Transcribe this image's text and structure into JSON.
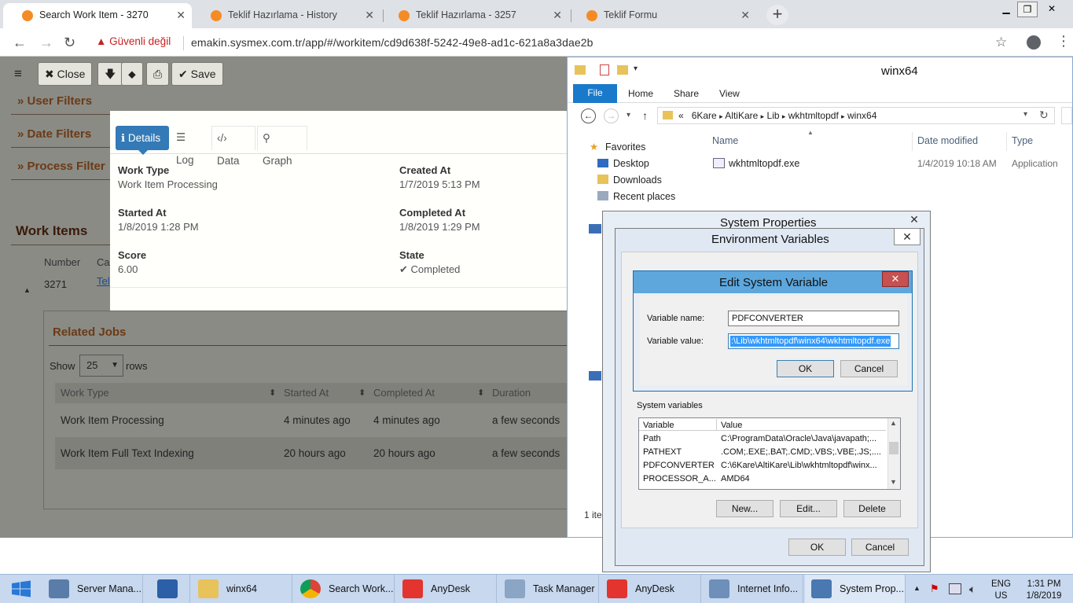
{
  "browser": {
    "tabs": [
      {
        "title": "Search Work Item - 3270",
        "active": true
      },
      {
        "title": "Teklif Hazırlama - History",
        "active": false
      },
      {
        "title": "Teklif Hazırlama - 3257",
        "active": false
      },
      {
        "title": "Teklif Formu",
        "active": false
      }
    ],
    "security_warning": "Güvenli değil",
    "url": "emakin.sysmex.com.tr/app/#/workitem/cd9d638f-5242-49e8-ad1c-621a8a3dae2b"
  },
  "toolbar": {
    "close_label": "Close",
    "save_label": "Save"
  },
  "filters": {
    "user": "» User Filters",
    "date": "» Date Filters",
    "process": "» Process Filter"
  },
  "work_items": {
    "title": "Work Items",
    "col_number": "Number",
    "col_ca": "Ca",
    "number": "3271",
    "link": "Tel"
  },
  "modal": {
    "tabs": {
      "details": "Details",
      "log": "Log",
      "data": "Data",
      "graph": "Graph"
    },
    "work_type_label": "Work Type",
    "work_type": "Work Item Processing",
    "created_at_label": "Created At",
    "created_at": "1/7/2019 5:13 PM",
    "started_at_label": "Started At",
    "started_at": "1/8/2019 1:28 PM",
    "completed_at_label": "Completed At",
    "completed_at": "1/8/2019 1:29 PM",
    "score_label": "Score",
    "score": "6.00",
    "state_label": "State",
    "state": "Completed"
  },
  "related_jobs": {
    "title": "Related Jobs",
    "show": "Show",
    "page_size": "25",
    "rows": "rows",
    "columns": [
      "Work Type",
      "Started At",
      "Completed At",
      "Duration"
    ],
    "data": [
      [
        "Work Item Processing",
        "4 minutes ago",
        "4 minutes ago",
        "a few seconds"
      ],
      [
        "Work Item Full Text Indexing",
        "20 hours ago",
        "20 hours ago",
        "a few seconds"
      ]
    ]
  },
  "explorer": {
    "title": "winx64",
    "ribbon": {
      "file": "File",
      "home": "Home",
      "share": "Share",
      "view": "View"
    },
    "path": [
      "«",
      "6Kare",
      "AltiKare",
      "Lib",
      "wkhtmltopdf",
      "winx64"
    ],
    "nav": {
      "favorites": "Favorites",
      "desktop": "Desktop",
      "downloads": "Downloads",
      "recent": "Recent places"
    },
    "columns": {
      "name": "Name",
      "date": "Date modified",
      "type": "Type"
    },
    "file": {
      "name": "wkhtmltopdf.exe",
      "date": "1/4/2019 10:18 AM",
      "type": "Application"
    },
    "status": "1 ite"
  },
  "system_properties": {
    "title": "System Properties"
  },
  "env_vars": {
    "title": "Environment Variables",
    "system_label": "System variables",
    "col_variable": "Variable",
    "col_value": "Value",
    "vars": [
      [
        "Path",
        "C:\\ProgramData\\Oracle\\Java\\javapath;..."
      ],
      [
        "PATHEXT",
        ".COM;.EXE;.BAT;.CMD;.VBS;.VBE;.JS;...."
      ],
      [
        "PDFCONVERTER",
        "C:\\6Kare\\AltiKare\\Lib\\wkhtmltopdf\\winx..."
      ],
      [
        "PROCESSOR_A...",
        "AMD64"
      ]
    ],
    "new": "New...",
    "edit": "Edit...",
    "delete": "Delete",
    "ok": "OK",
    "cancel": "Cancel"
  },
  "edit_var": {
    "title": "Edit System Variable",
    "name_label": "Variable name:",
    "name_value": "PDFCONVERTER",
    "value_label": "Variable value:",
    "value_value": ":\\Lib\\wkhtmltopdf\\winx64\\wkhtmltopdf.exe",
    "ok": "OK",
    "cancel": "Cancel"
  },
  "taskbar": {
    "items": [
      "Server Mana...",
      "winx64",
      "Search Work...",
      "AnyDesk",
      "Task Manager",
      "AnyDesk",
      "Internet Info...",
      "System Prop..."
    ],
    "lang": "ENG",
    "region": "US",
    "time": "1:31 PM",
    "date": "1/8/2019"
  }
}
